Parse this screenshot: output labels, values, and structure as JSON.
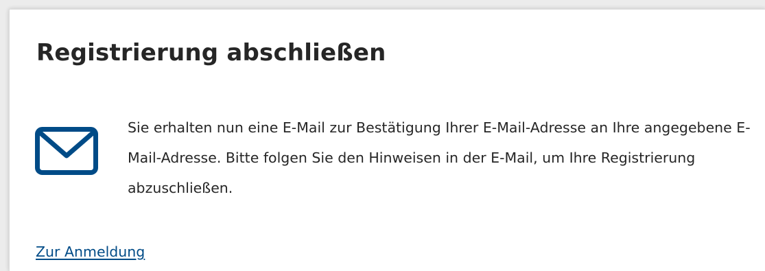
{
  "page": {
    "title": "Registrierung abschließen"
  },
  "notice": {
    "icon": "envelope-icon",
    "icon_color": "#004b87",
    "message": "Sie erhalten nun eine E-Mail zur Bestätigung Ihrer E-Mail-Adresse an Ihre angegebene E-Mail-Adresse. Bitte folgen Sie den Hinweisen in der E-Mail, um Ihre Registrierung abzuschließen."
  },
  "actions": {
    "login_link_label": "Zur Anmeldung",
    "link_color": "#004b87"
  }
}
